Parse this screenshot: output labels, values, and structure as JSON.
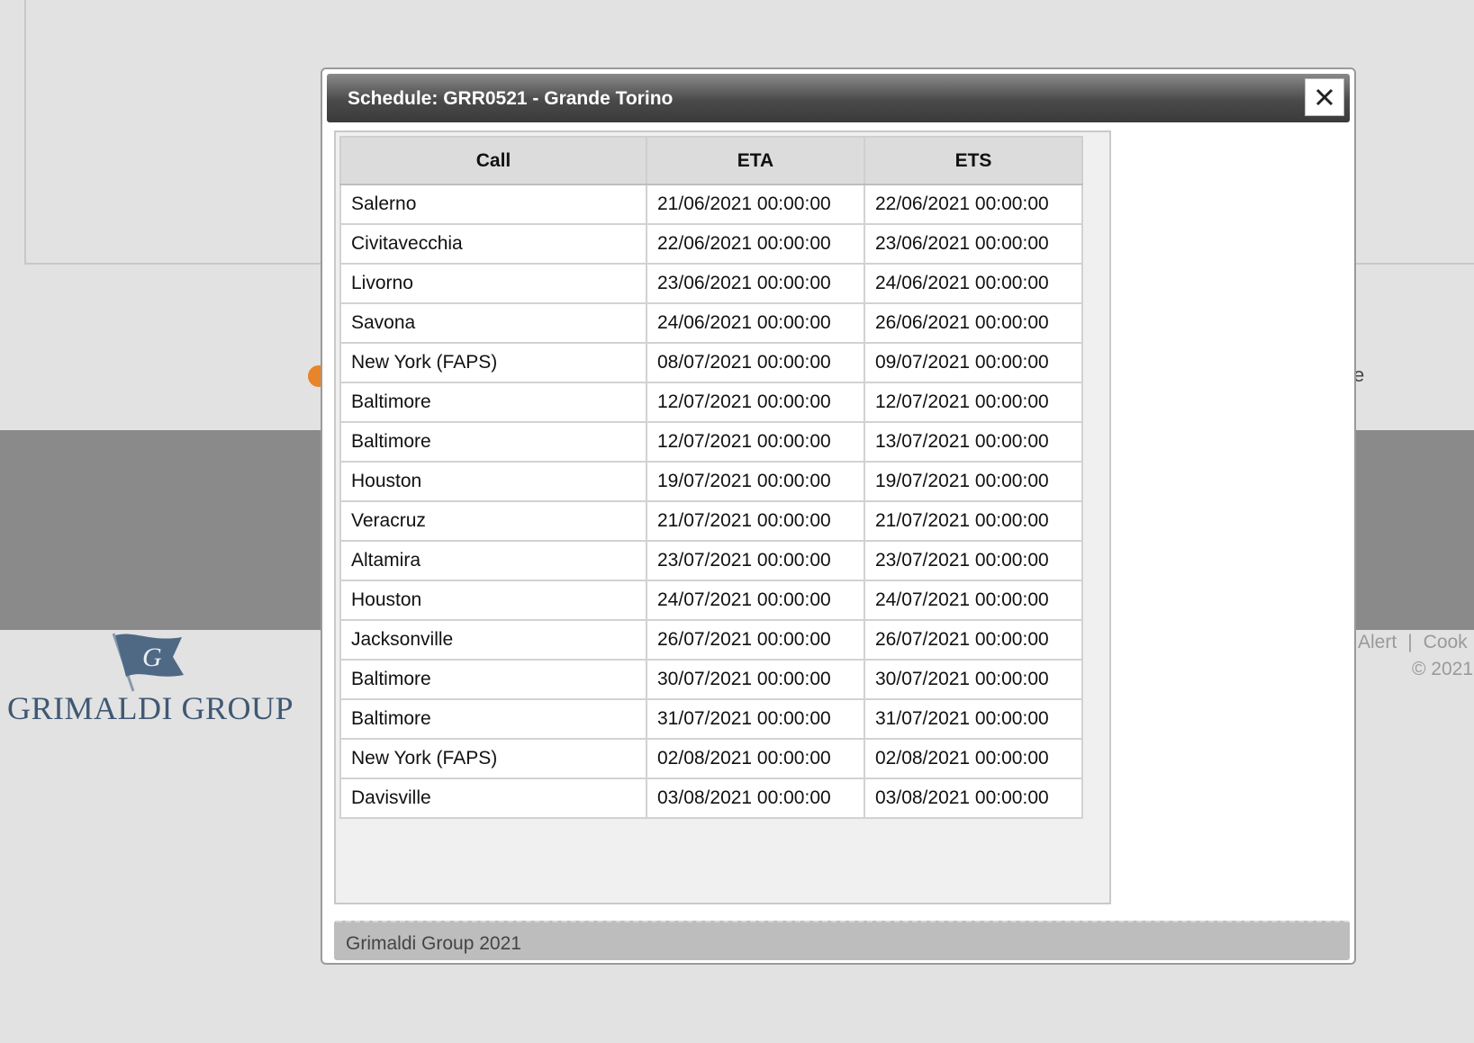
{
  "background": {
    "edge_text": "e",
    "footer_links": [
      "Alert",
      "Cook"
    ],
    "footer_separator": "|",
    "copyright": "© 2021",
    "logo_text": "GRIMALDI GROUP"
  },
  "dialog": {
    "title": "Schedule: GRR0521 - Grande Torino",
    "close_icon": "close-icon",
    "columns": [
      "Call",
      "ETA",
      "ETS"
    ],
    "rows": [
      {
        "call": "Salerno",
        "eta": "21/06/2021 00:00:00",
        "ets": "22/06/2021 00:00:00"
      },
      {
        "call": "Civitavecchia",
        "eta": "22/06/2021 00:00:00",
        "ets": "23/06/2021 00:00:00"
      },
      {
        "call": "Livorno",
        "eta": "23/06/2021 00:00:00",
        "ets": "24/06/2021 00:00:00"
      },
      {
        "call": "Savona",
        "eta": "24/06/2021 00:00:00",
        "ets": "26/06/2021 00:00:00"
      },
      {
        "call": "New York (FAPS)",
        "eta": "08/07/2021 00:00:00",
        "ets": "09/07/2021 00:00:00"
      },
      {
        "call": "Baltimore",
        "eta": "12/07/2021 00:00:00",
        "ets": "12/07/2021 00:00:00"
      },
      {
        "call": "Baltimore",
        "eta": "12/07/2021 00:00:00",
        "ets": "13/07/2021 00:00:00"
      },
      {
        "call": "Houston",
        "eta": "19/07/2021 00:00:00",
        "ets": "19/07/2021 00:00:00"
      },
      {
        "call": "Veracruz",
        "eta": "21/07/2021 00:00:00",
        "ets": "21/07/2021 00:00:00"
      },
      {
        "call": "Altamira",
        "eta": "23/07/2021 00:00:00",
        "ets": "23/07/2021 00:00:00"
      },
      {
        "call": "Houston",
        "eta": "24/07/2021 00:00:00",
        "ets": "24/07/2021 00:00:00"
      },
      {
        "call": "Jacksonville",
        "eta": "26/07/2021 00:00:00",
        "ets": "26/07/2021 00:00:00"
      },
      {
        "call": "Baltimore",
        "eta": "30/07/2021 00:00:00",
        "ets": "30/07/2021 00:00:00"
      },
      {
        "call": "Baltimore",
        "eta": "31/07/2021 00:00:00",
        "ets": "31/07/2021 00:00:00"
      },
      {
        "call": "New York (FAPS)",
        "eta": "02/08/2021 00:00:00",
        "ets": "02/08/2021 00:00:00"
      },
      {
        "call": "Davisville",
        "eta": "03/08/2021 00:00:00",
        "ets": "03/08/2021 00:00:00"
      }
    ],
    "footer": "Grimaldi Group 2021"
  },
  "colors": {
    "accent_orange": "#e8842a",
    "logo_blue": "#3f5873",
    "titlebar_dark": "#3a3a3a"
  }
}
